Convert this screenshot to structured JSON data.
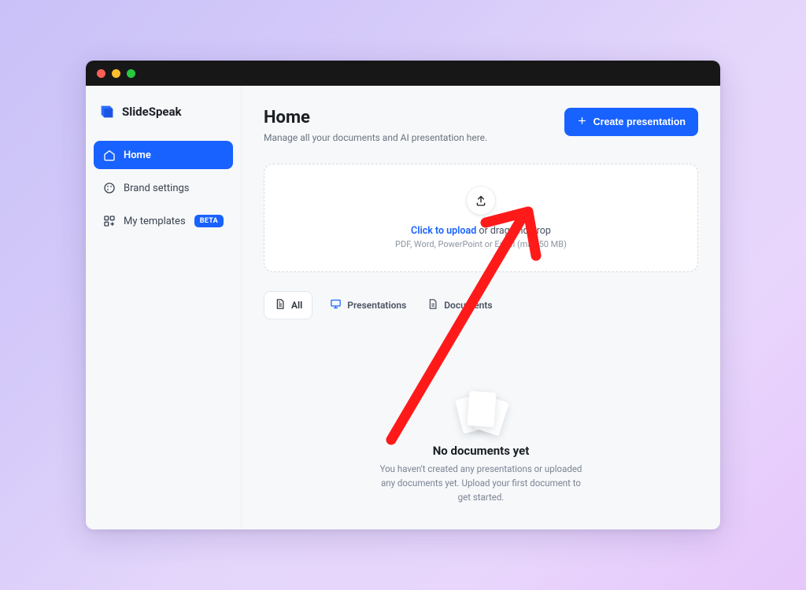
{
  "brand": {
    "name": "SlideSpeak"
  },
  "sidebar": {
    "items": [
      {
        "label": "Home"
      },
      {
        "label": "Brand settings"
      },
      {
        "label": "My templates",
        "badge": "BETA"
      }
    ]
  },
  "header": {
    "title": "Home",
    "subtitle": "Manage all your documents and AI presentation here.",
    "create_btn": "Create presentation"
  },
  "dropzone": {
    "link_text": "Click to upload",
    "rest_text": " or drag and drop",
    "sub": "PDF, Word, PowerPoint or Excel (max 50 MB)"
  },
  "filters": {
    "all": "All",
    "presentations": "Presentations",
    "documents": "Documents"
  },
  "empty": {
    "title": "No documents yet",
    "text": "You haven't created any presentations or uploaded any documents yet. Upload your first document to get started."
  }
}
